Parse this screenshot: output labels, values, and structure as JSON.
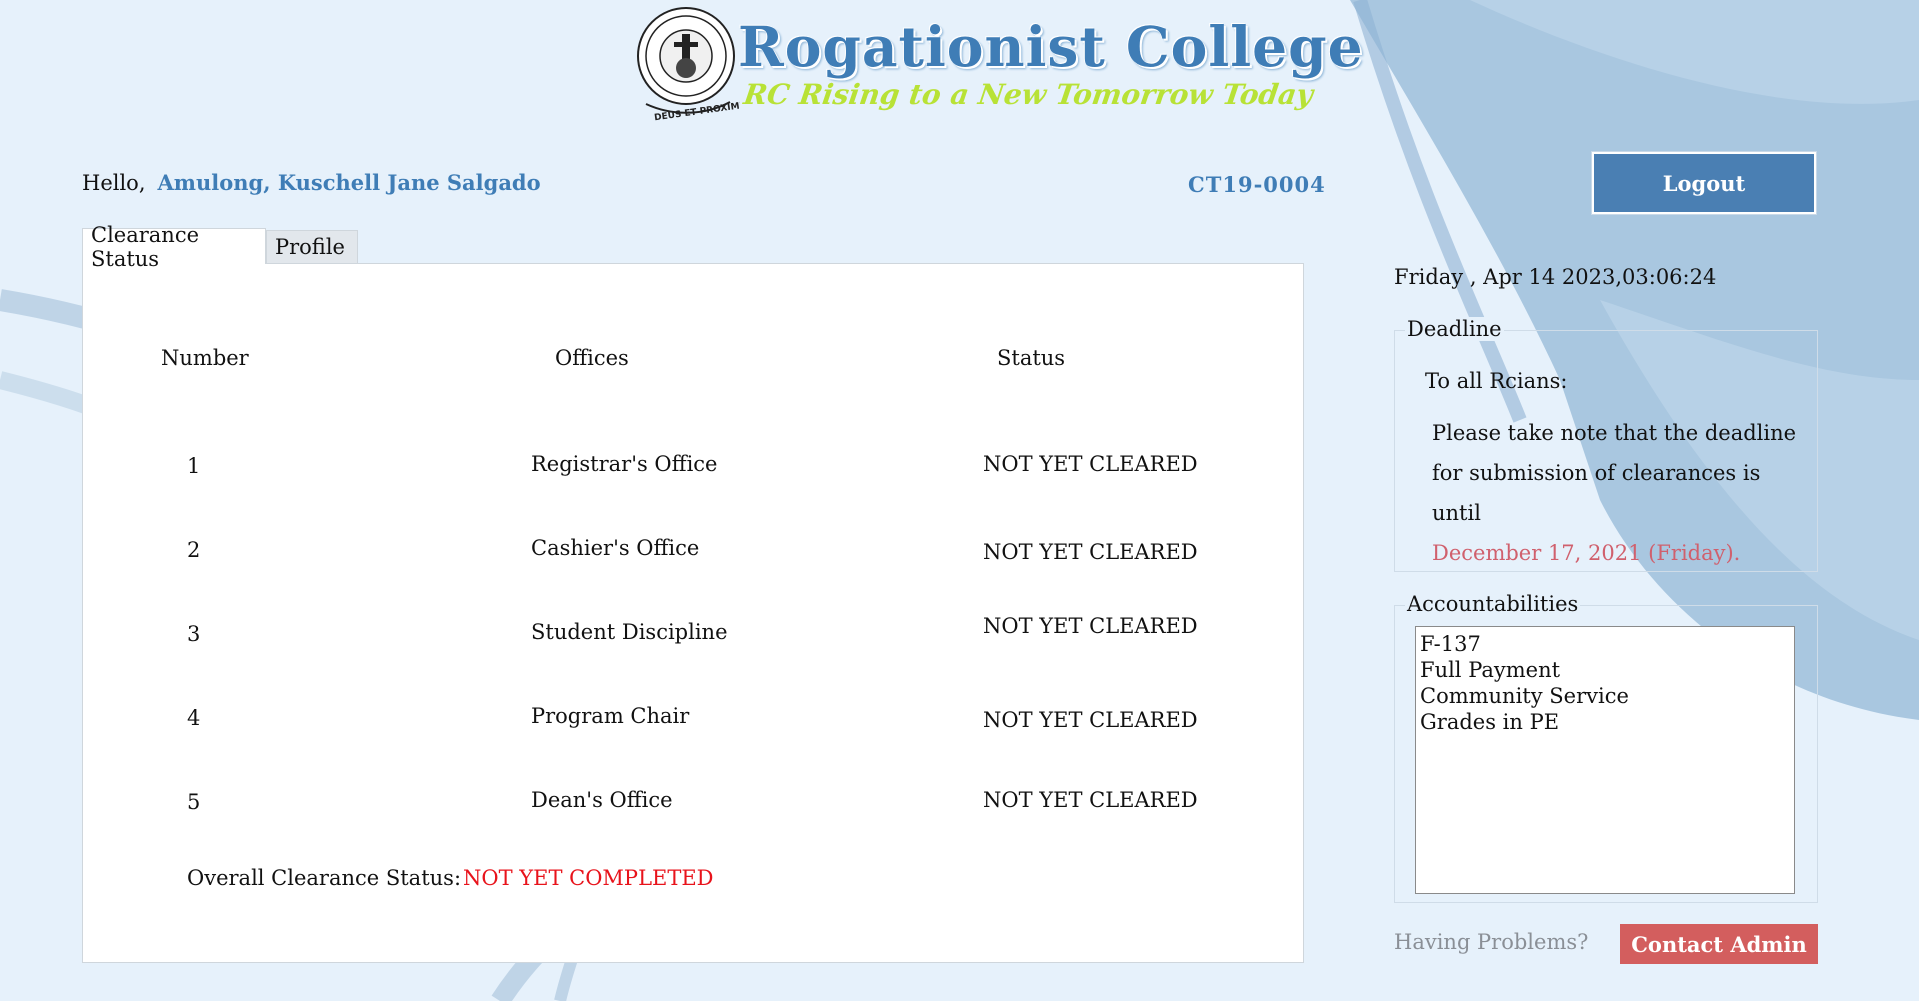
{
  "header": {
    "brand_title": "Rogationist College",
    "brand_tagline": "RC Rising to a New Tomorrow Today",
    "seal_motto": "DEUS ET PROXIMUS"
  },
  "greeting": {
    "hello": "Hello,",
    "name": "Amulong, Kuschell Jane Salgado",
    "student_id": "CT19-0004"
  },
  "logout_label": "Logout",
  "tabs": [
    {
      "label": "Clearance Status",
      "active": true
    },
    {
      "label": "Profile",
      "active": false
    }
  ],
  "clearance": {
    "headers": {
      "number": "Number",
      "offices": "Offices",
      "status": "Status"
    },
    "rows": [
      {
        "number": "1",
        "office": "Registrar's Office",
        "status": "NOT YET CLEARED"
      },
      {
        "number": "2",
        "office": "Cashier's Office",
        "status": "NOT YET CLEARED"
      },
      {
        "number": "3",
        "office": "Student Discipline",
        "status": "NOT YET CLEARED"
      },
      {
        "number": "4",
        "office": "Program Chair",
        "status": "NOT YET CLEARED"
      },
      {
        "number": "5",
        "office": "Dean's Office",
        "status": "NOT YET CLEARED"
      }
    ],
    "overall_label": "Overall Clearance Status:",
    "overall_value": "NOT YET COMPLETED"
  },
  "datetime": "Friday , Apr 14 2023,03:06:24",
  "deadline": {
    "legend": "Deadline",
    "to": "To all Rcians:",
    "message": "Please take note that the deadline for submission of clearances is until",
    "date": "December 17, 2021 (Friday)."
  },
  "accountabilities": {
    "legend": "Accountabilities",
    "items": [
      "F-137",
      "Full Payment",
      "Community Service",
      "Grades in PE"
    ]
  },
  "help": {
    "text": "Having Problems?",
    "contact_label": "Contact Admin"
  },
  "colors": {
    "accent": "#4a7fb3",
    "name_blue": "#3f7db6",
    "alert_red": "#e8131b",
    "contact_red": "#d35e5e",
    "deadline_date": "#d0606d",
    "background": "#e6f1fb"
  }
}
